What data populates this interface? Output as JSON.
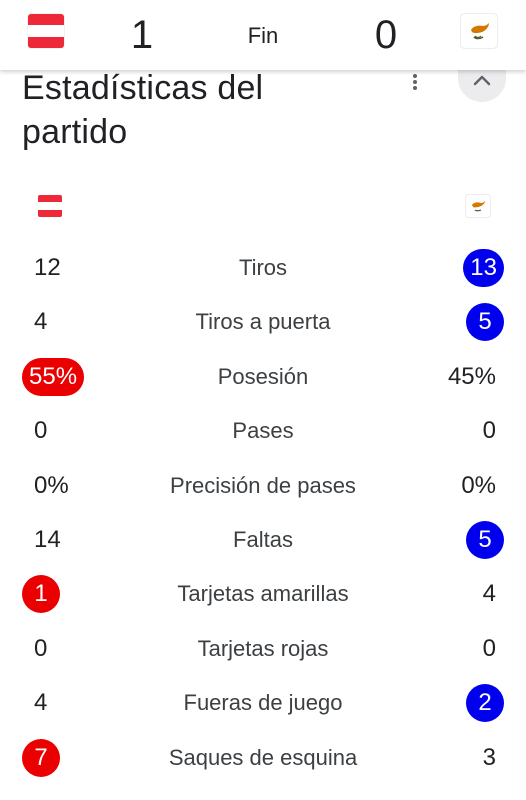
{
  "scorebar": {
    "home_score": "1",
    "status": "Fin",
    "away_score": "0",
    "home_flag": "austria-flag-icon",
    "away_flag": "cyprus-flag-icon"
  },
  "section": {
    "title": "Estadísticas del partido",
    "more_icon": "more-vert-icon",
    "collapse_icon": "chevron-up-icon"
  },
  "colors": {
    "home_highlight": "#ea0000",
    "away_highlight": "#0000ee"
  },
  "stats": [
    {
      "label": "Tiros",
      "home": "12",
      "away": "13",
      "leader": "away"
    },
    {
      "label": "Tiros a puerta",
      "home": "4",
      "away": "5",
      "leader": "away"
    },
    {
      "label": "Posesión",
      "home": "55%",
      "away": "45%",
      "leader": "home"
    },
    {
      "label": "Pases",
      "home": "0",
      "away": "0",
      "leader": "none"
    },
    {
      "label": "Precisión de pases",
      "home": "0%",
      "away": "0%",
      "leader": "none"
    },
    {
      "label": "Faltas",
      "home": "14",
      "away": "5",
      "leader": "away"
    },
    {
      "label": "Tarjetas amarillas",
      "home": "1",
      "away": "4",
      "leader": "home"
    },
    {
      "label": "Tarjetas rojas",
      "home": "0",
      "away": "0",
      "leader": "none"
    },
    {
      "label": "Fueras de juego",
      "home": "4",
      "away": "2",
      "leader": "away"
    },
    {
      "label": "Saques de esquina",
      "home": "7",
      "away": "3",
      "leader": "home"
    }
  ]
}
